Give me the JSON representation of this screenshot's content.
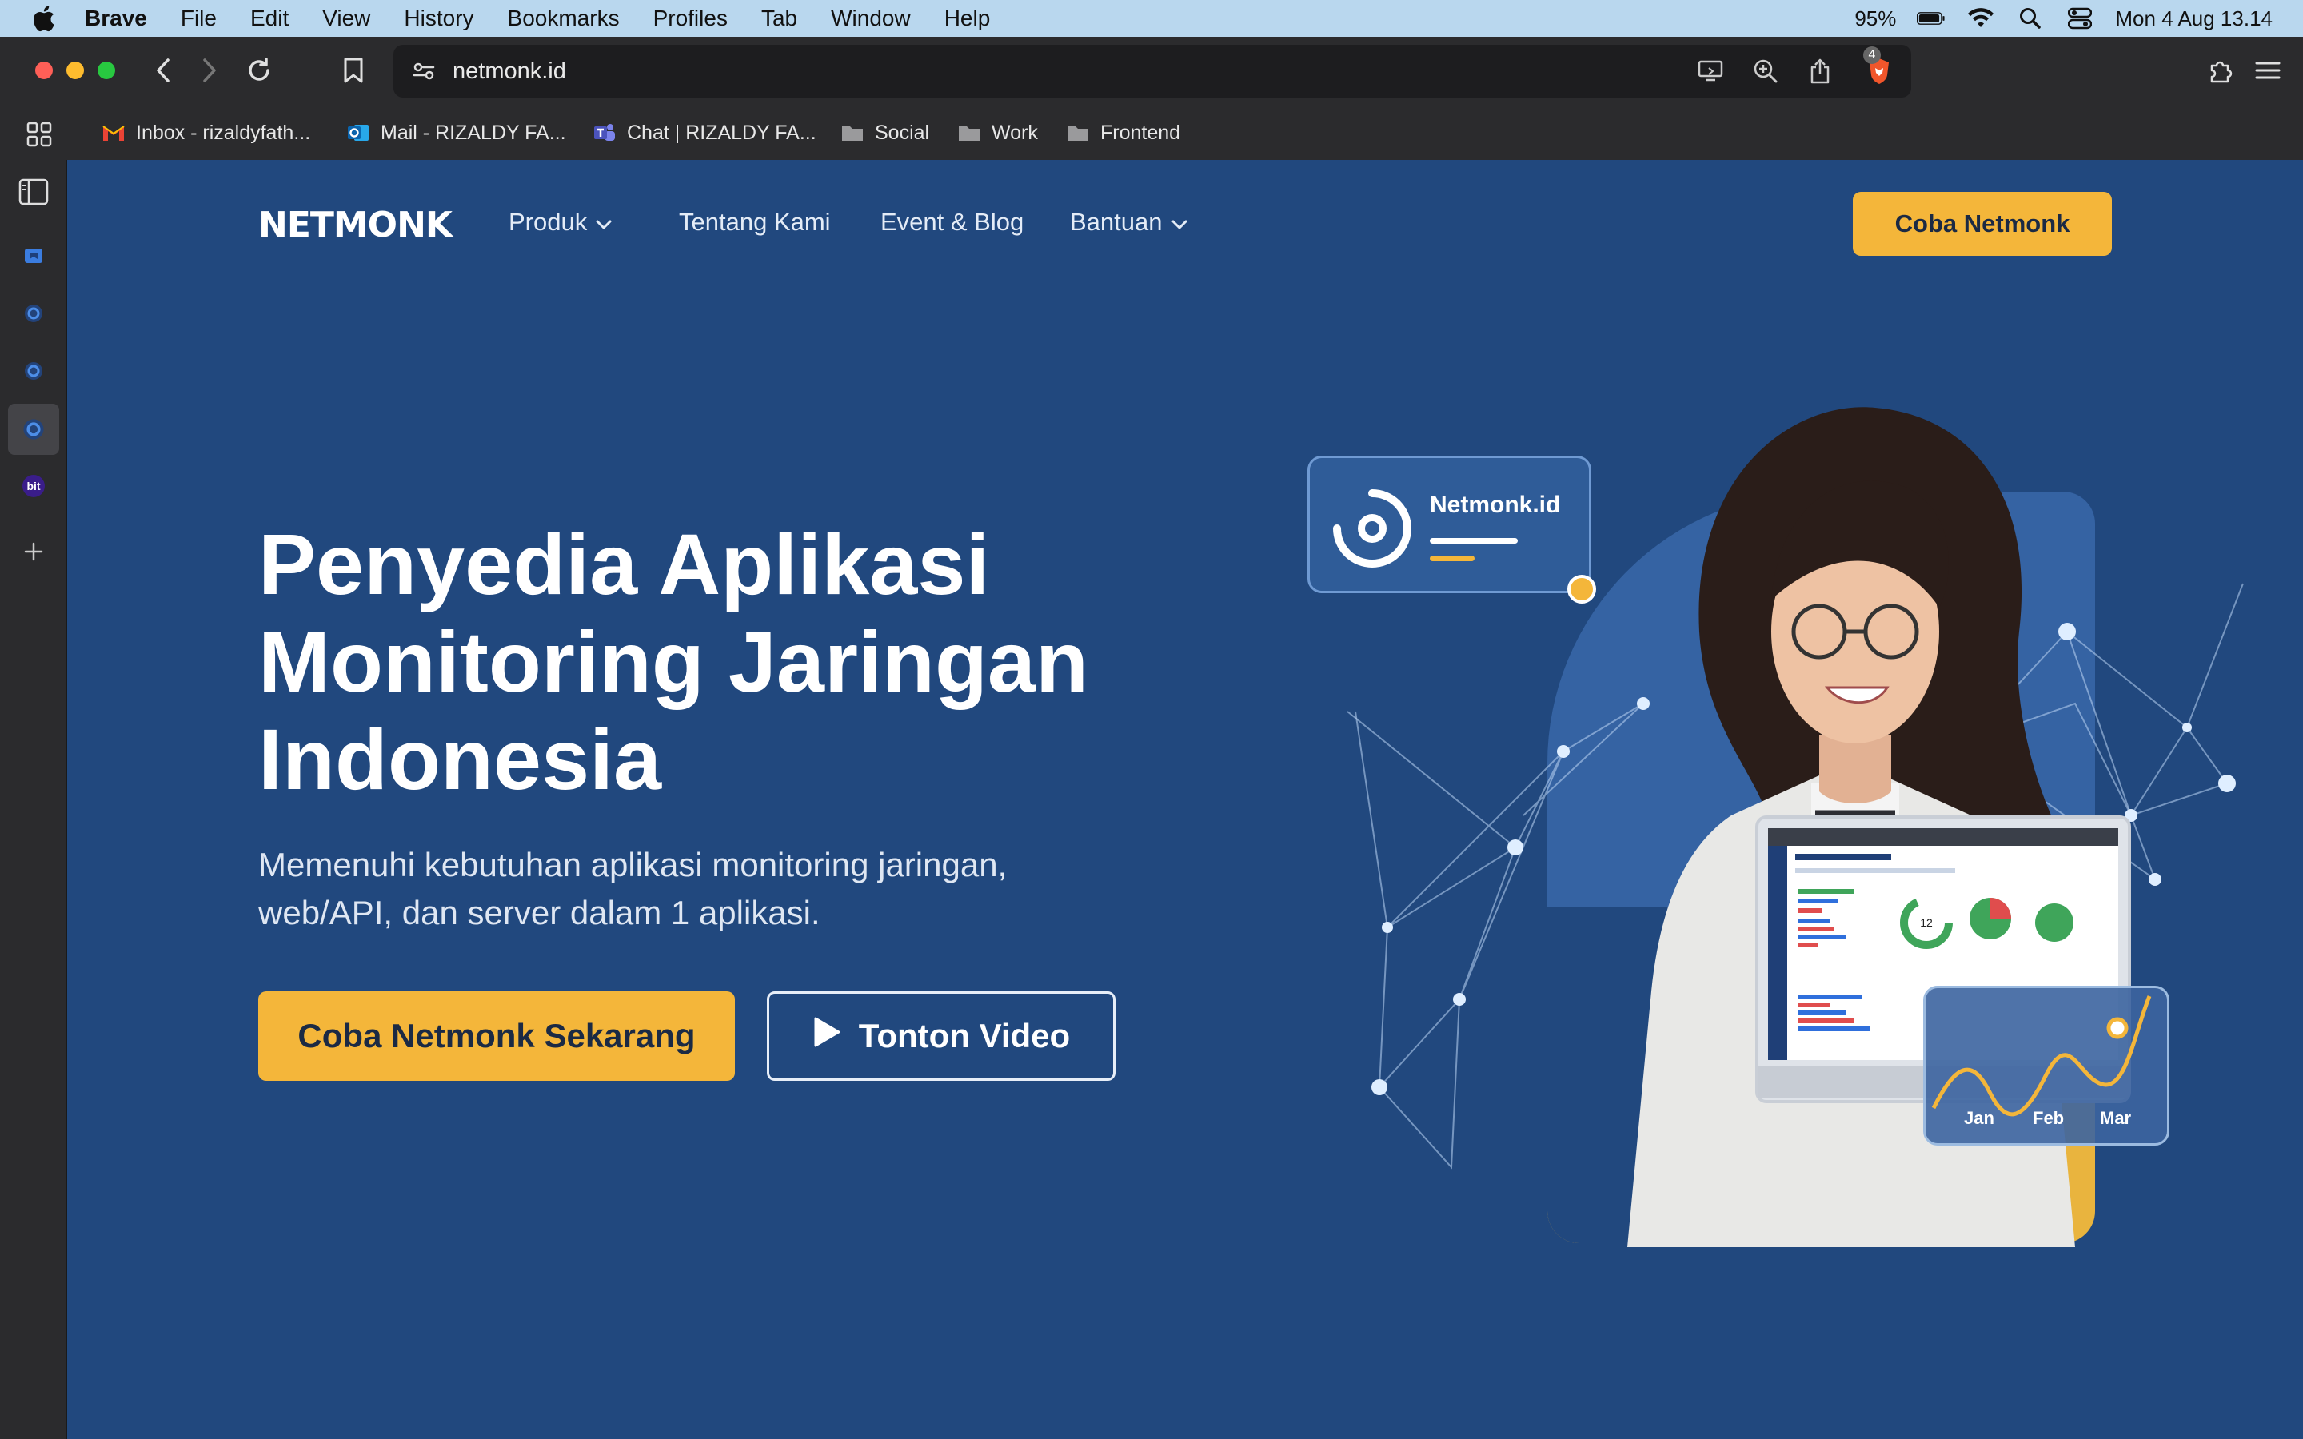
{
  "menubar": {
    "app": "Brave",
    "items": [
      "File",
      "Edit",
      "View",
      "History",
      "Bookmarks",
      "Profiles",
      "Tab",
      "Window",
      "Help"
    ],
    "battery": "95%",
    "datetime": "Mon 4 Aug  13.14"
  },
  "browser": {
    "url": "netmonk.id",
    "brave_badge": "4",
    "bookmarks": [
      {
        "label": "Inbox - rizaldyfath...",
        "icon": "gmail-icon"
      },
      {
        "label": "Mail - RIZALDY FA...",
        "icon": "outlook-icon"
      },
      {
        "label": "Chat | RIZALDY FA...",
        "icon": "teams-icon"
      },
      {
        "label": "Social",
        "icon": "folder-icon"
      },
      {
        "label": "Work",
        "icon": "folder-icon"
      },
      {
        "label": "Frontend",
        "icon": "folder-icon"
      }
    ],
    "sidebar_bit_label": "bit"
  },
  "site": {
    "logo": "NETMONK",
    "nav": {
      "produk": "Produk",
      "tentang": "Tentang Kami",
      "event": "Event & Blog",
      "bantuan": "Bantuan"
    },
    "cta_top": "Coba Netmonk",
    "hero": {
      "title_line1": "Penyedia Aplikasi",
      "title_line2": "Monitoring Jaringan",
      "title_line3": "Indonesia",
      "subtitle_line1": "Memenuhi kebutuhan aplikasi monitoring jaringan,",
      "subtitle_line2": "web/API, dan server dalam 1 aplikasi.",
      "primary_button": "Coba Netmonk Sekarang",
      "secondary_button": "Tonton Video"
    },
    "illustration": {
      "card_title": "Netmonk.id",
      "chart_months": [
        "Jan",
        "Feb",
        "Mar"
      ],
      "gauge_value": "12"
    }
  },
  "colors": {
    "page_bg": "#21487e",
    "accent": "#f4b63a"
  }
}
